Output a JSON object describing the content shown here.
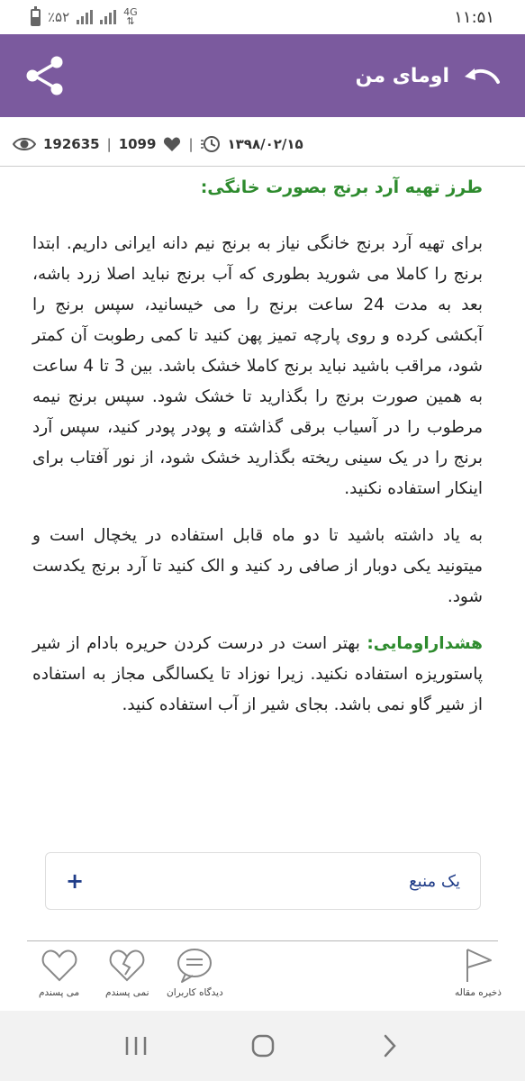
{
  "status_bar": {
    "time": "۱۱:۵۱",
    "battery_percent": "٪۵۲",
    "network_type": "4G",
    "battery_level": 0.52
  },
  "app_bar": {
    "title": "اومای من",
    "share_icon": "share-icon",
    "back_icon": "back-arrow-icon",
    "background_color": "#7b5a9e"
  },
  "meta": {
    "views": "192635",
    "likes": "1099",
    "date": "۱۳۹۸/۰۲/۱۵"
  },
  "article": {
    "title": "طرز تهیه آرد برنج بصورت خانگی:",
    "paragraphs": [
      "برای تهیه آرد برنج خانگی نیاز به برنج نیم دانه ایرانی داریم. ابتدا برنج را کاملا می شورید بطوری که آب برنج نباید اصلا زرد باشه، بعد به مدت 24 ساعت برنج را می خیسانید، سپس برنج را آبکشی کرده و روی پارچه تمیز پهن کنید تا کمی رطوبت آن کمتر شود، مراقب باشید نباید برنج کاملا خشک باشد. بین 3 تا 4 ساعت به همین صورت برنج را بگذارید تا خشک شود. سپس برنج نیمه مرطوب را در آسیاب برقی گذاشته و پودر پودر کنید، سپس آرد برنج را در یک سینی ریخته بگذارید خشک شود، از نور آفتاب برای اینکار استفاده نکنید.",
      "به یاد داشته باشید تا دو ماه قابل استفاده در یخچال است و میتونید یکی دوبار از صافی رد کنید و الک کنید تا آرد برنج یکدست شود."
    ],
    "warning_label": "هشداراومایی:",
    "warning_text": " بهتر است در درست کردن حریره بادام از شیر پاستوریزه استفاده نکنید. زیرا نوزاد تا یکسالگی مجاز به استفاده از شیر گاو نمی باشد. بجای شیر از آب استفاده کنید.",
    "accent_color": "#2e8b2e"
  },
  "source_box": {
    "label": "یک منبع",
    "expand_symbol": "+"
  },
  "actions": {
    "save": "ذخیره مقاله",
    "comments": "دیدگاه کاربران",
    "dislike": "نمی پسندم",
    "like": "می پسندم"
  }
}
